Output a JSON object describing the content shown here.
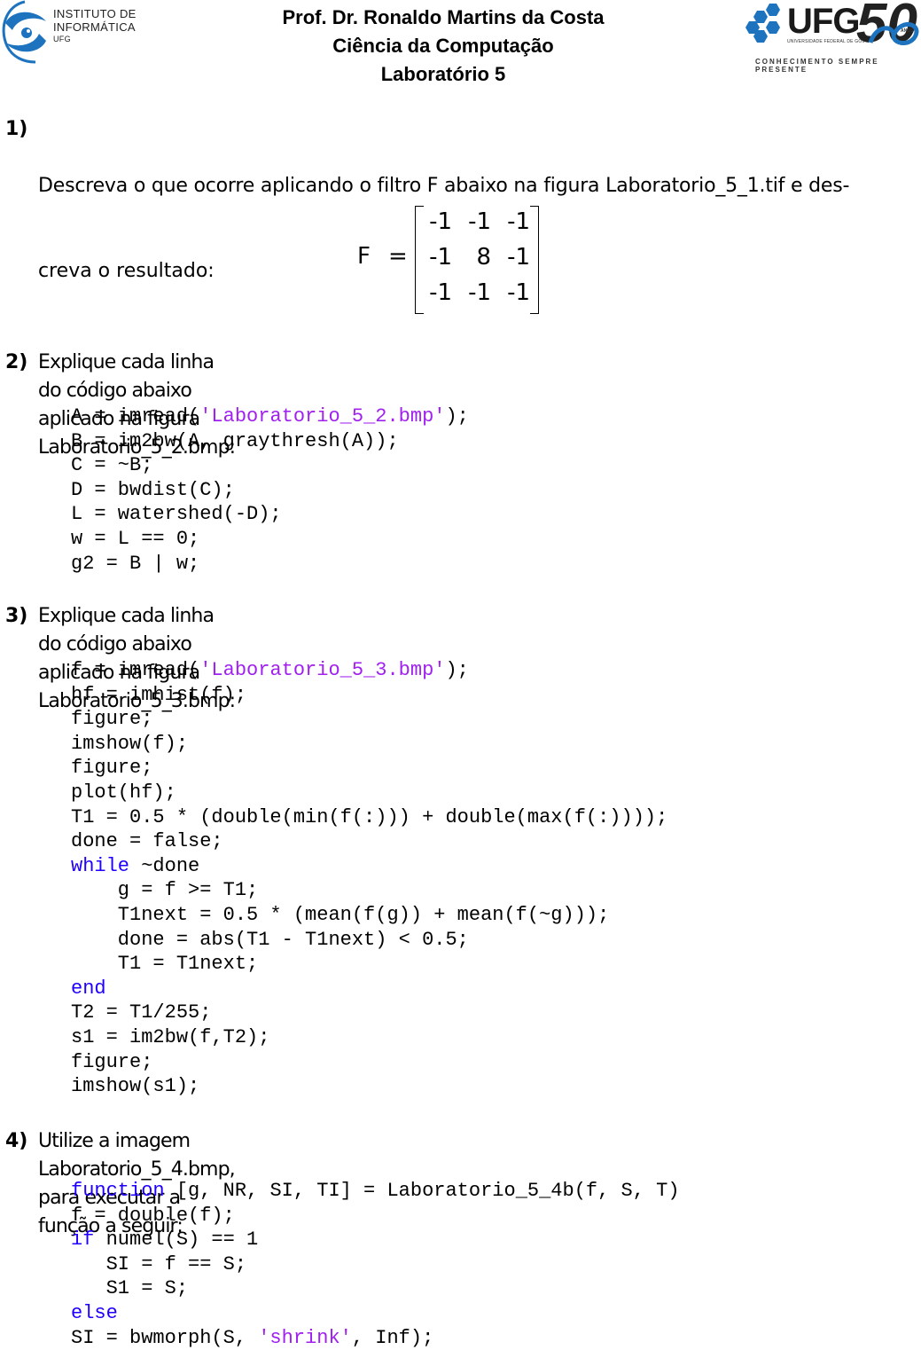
{
  "header": {
    "left_logo": {
      "line1": "INSTITUTO DE",
      "line2": "INFORMÁTICA",
      "line3": "UFG",
      "icon": "instituto-informatica-logo"
    },
    "title_lines": [
      "Prof. Dr. Ronaldo Martins da Costa",
      "Ciência da Computação",
      "Laboratório 5"
    ],
    "right_logo": {
      "name": "UFG",
      "subtitle": "UNIVERSIDADE FEDERAL DE GOIÁS",
      "anniversary": "50",
      "anniversary_label": "ANOS",
      "motto": "CONHECIMENTO SEMPRE PRESENTE",
      "icon": "ufg-hexagon-logo",
      "brand_color": "#1e73be"
    }
  },
  "colors": {
    "keyword": "#1f00ff",
    "string": "#a020f0",
    "text": "#000000"
  },
  "questions": [
    {
      "number": "1)",
      "text": "Descreva o que ocorre aplicando o filtro F abaixo na figura Laboratorio_5_1.tif e descreva o resultado:",
      "text_lines": [
        "Descreva o que ocorre aplicando o filtro F abaixo na figura Laboratorio_5_1.tif e des-",
        "creva o resultado:"
      ],
      "matrix": {
        "label": "F",
        "equals": "=",
        "rows": [
          [
            "-1",
            "-1",
            "-1"
          ],
          [
            "-1",
            "8",
            "-1"
          ],
          [
            "-1",
            "-1",
            "-1"
          ]
        ]
      }
    },
    {
      "number": "2)",
      "text": "Explique cada linha do código abaixo aplicado na figura Laboratorio_5_2.bmp:",
      "code": [
        [
          {
            "t": "A = imread("
          },
          {
            "t": "'Laboratorio_5_2.bmp'",
            "c": "str"
          },
          {
            "t": ");"
          }
        ],
        [
          {
            "t": "B = im2bw(A, graythresh(A));"
          }
        ],
        [
          {
            "t": "C = ~B;"
          }
        ],
        [
          {
            "t": "D = bwdist(C);"
          }
        ],
        [
          {
            "t": "L = watershed(-D);"
          }
        ],
        [
          {
            "t": "w = L == 0;"
          }
        ],
        [
          {
            "t": "g2 = B | w;"
          }
        ]
      ]
    },
    {
      "number": "3)",
      "text": "Explique cada linha do código abaixo aplicado na figura Laboratorio_5_3.bmp:",
      "code": [
        [
          {
            "t": "f = imread("
          },
          {
            "t": "'Laboratorio_5_3.bmp'",
            "c": "str"
          },
          {
            "t": ");"
          }
        ],
        [
          {
            "t": "hf = imhist(f);"
          }
        ],
        [
          {
            "t": "figure;"
          }
        ],
        [
          {
            "t": "imshow(f);"
          }
        ],
        [
          {
            "t": "figure;"
          }
        ],
        [
          {
            "t": "plot(hf);"
          }
        ],
        [
          {
            "t": "T1 = 0.5 * (double(min(f(:))) + double(max(f(:))));"
          }
        ],
        [
          {
            "t": "done = false;"
          }
        ],
        [
          {
            "t": "while",
            "c": "kw"
          },
          {
            "t": " ~done"
          }
        ],
        [
          {
            "t": "    g = f >= T1;"
          }
        ],
        [
          {
            "t": "    T1next = 0.5 * (mean(f(g)) + mean(f(~g)));"
          }
        ],
        [
          {
            "t": "    done = abs(T1 - T1next) < 0.5;"
          }
        ],
        [
          {
            "t": "    T1 = T1next;"
          }
        ],
        [
          {
            "t": "end",
            "c": "kw"
          }
        ],
        [
          {
            "t": "T2 = T1/255;"
          }
        ],
        [
          {
            "t": "s1 = im2bw(f,T2);"
          }
        ],
        [
          {
            "t": "figure;"
          }
        ],
        [
          {
            "t": "imshow(s1);"
          }
        ]
      ]
    },
    {
      "number": "4)",
      "text": "Utilize a imagem Laboratorio_5_4.bmp, para executar a função a seguir:",
      "code": [
        [
          {
            "t": "function",
            "c": "kw"
          },
          {
            "t": " [g, NR, SI, TI] = Laboratorio_5_4b(f, S, T)"
          }
        ],
        [
          {
            "t": "f = double(f);"
          }
        ],
        [
          {
            "t": "if",
            "c": "kw"
          },
          {
            "t": " numel(S) == 1"
          }
        ],
        [
          {
            "t": "   SI = f == S;"
          }
        ],
        [
          {
            "t": "   S1 = S;"
          }
        ],
        [
          {
            "t": "else",
            "c": "kw"
          }
        ],
        [
          {
            "t": "SI = bwmorph(S, "
          },
          {
            "t": "'shrink'",
            "c": "str"
          },
          {
            "t": ", Inf);"
          }
        ]
      ]
    }
  ]
}
